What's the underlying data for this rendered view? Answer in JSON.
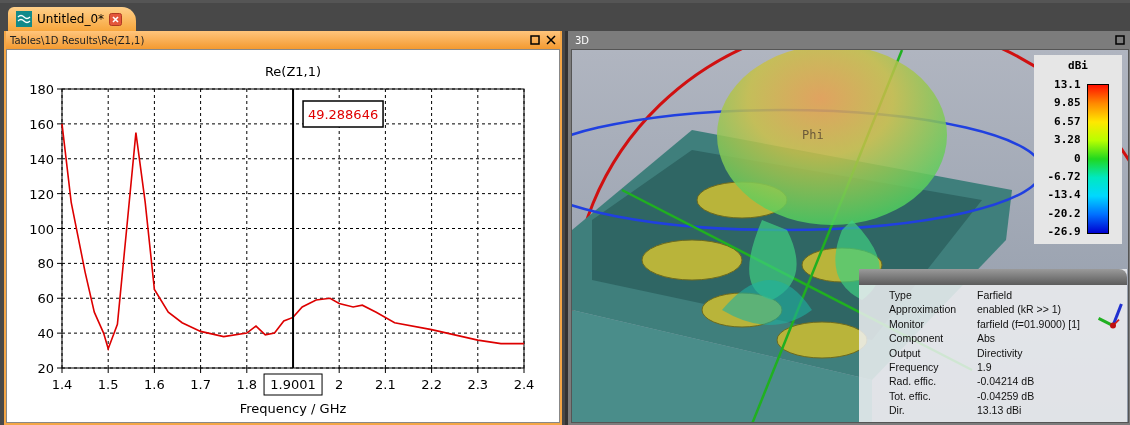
{
  "document_tab": {
    "label": "Untitled_0*",
    "selected": true
  },
  "left_panel": {
    "title": "Tables\\1D Results\\Re(Z1,1)",
    "chart_data": {
      "type": "line",
      "title": "Re(Z1,1)",
      "xlabel": "Frequency / GHz",
      "x": [
        1.4,
        1.42,
        1.45,
        1.47,
        1.49,
        1.5,
        1.52,
        1.54,
        1.56,
        1.58,
        1.6,
        1.63,
        1.66,
        1.7,
        1.75,
        1.8,
        1.82,
        1.84,
        1.86,
        1.88,
        1.9,
        1.92,
        1.95,
        1.98,
        2.0,
        2.03,
        2.05,
        2.08,
        2.12,
        2.2,
        2.3,
        2.35,
        2.4
      ],
      "series": [
        {
          "color": "#dd0000",
          "values": [
            160,
            115,
            75,
            52,
            40,
            31,
            45,
            100,
            155,
            115,
            65,
            52,
            46,
            41,
            38,
            40,
            44,
            39,
            40,
            47,
            49,
            55,
            59,
            60,
            57,
            55,
            56,
            52,
            46,
            42,
            36,
            34,
            34
          ]
        }
      ],
      "xlim": [
        1.4,
        2.4
      ],
      "ylim": [
        20,
        180
      ],
      "xticks": [
        1.4,
        1.5,
        1.6,
        1.7,
        1.8,
        2,
        2.1,
        2.2,
        2.3,
        2.4
      ],
      "grid": true,
      "yticks": [
        20,
        40,
        60,
        80,
        100,
        120,
        140,
        160,
        180
      ],
      "ref_lines": [
        {
          "axis": "x",
          "value": 1.9001,
          "label": "1.9001"
        }
      ],
      "annotations": [
        {
          "text": "49.288646"
        }
      ]
    }
  },
  "right_panel": {
    "title": "3D",
    "scene_label": "Phi",
    "legend": {
      "unit": "dBi",
      "ticks": [
        "13.1",
        "9.85",
        "6.57",
        "3.28",
        "0",
        "-6.72",
        "-13.4",
        "-20.2",
        "-26.9"
      ]
    },
    "info": [
      {
        "key": "Type",
        "value": "Farfield"
      },
      {
        "key": "Approximation",
        "value": "enabled (kR >> 1)"
      },
      {
        "key": "Monitor",
        "value": "farfield (f=01.9000) [1]"
      },
      {
        "key": "Component",
        "value": "Abs"
      },
      {
        "key": "Output",
        "value": "Directivity"
      },
      {
        "key": "Frequency",
        "value": "1.9"
      },
      {
        "key": "Rad. effic.",
        "value": "-0.04214 dB"
      },
      {
        "key": "Tot. effic.",
        "value": "-0.04259 dB"
      },
      {
        "key": "Dir.",
        "value": "13.13 dBi"
      }
    ]
  }
}
